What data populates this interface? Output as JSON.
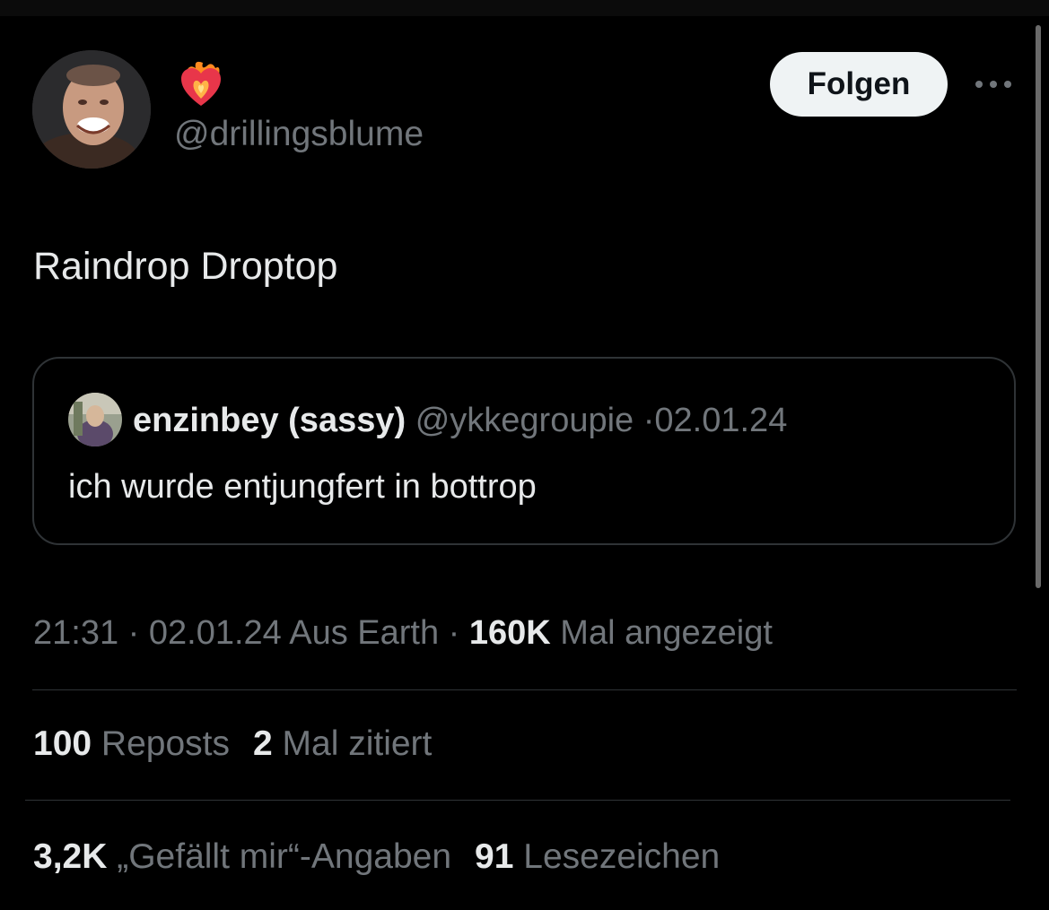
{
  "author": {
    "display_name_icon": "heart-on-fire-emoji",
    "handle": "@drillingsblume",
    "follow_label": "Folgen",
    "more_icon": "more-horizontal-icon"
  },
  "tweet": {
    "text": "Raindrop Droptop"
  },
  "quote": {
    "name": "enzinbey (sassy)",
    "handle": "@ykkegroupie",
    "sep": "·",
    "date": "02.01.24",
    "text": "ich wurde entjungfert in bottrop"
  },
  "meta": {
    "time": "21:31",
    "sep1": " · ",
    "date": "02.01.24",
    "source": " Aus Earth",
    "sep2": " · ",
    "views_value": "160K",
    "views_label": " Mal angezeigt"
  },
  "stats": {
    "reposts_value": "100",
    "reposts_label": " Reposts",
    "quotes_value": "2",
    "quotes_label": " Mal zitiert",
    "likes_value": "3,2K",
    "likes_label": " „Gefällt mir“-Angaben",
    "bookmarks_value": "91",
    "bookmarks_label": " Lesezeichen"
  },
  "colors": {
    "background": "#000000",
    "text_primary": "#e7e9ea",
    "text_secondary": "#71767b",
    "border": "#2f3336",
    "follow_bg": "#eff3f4"
  }
}
